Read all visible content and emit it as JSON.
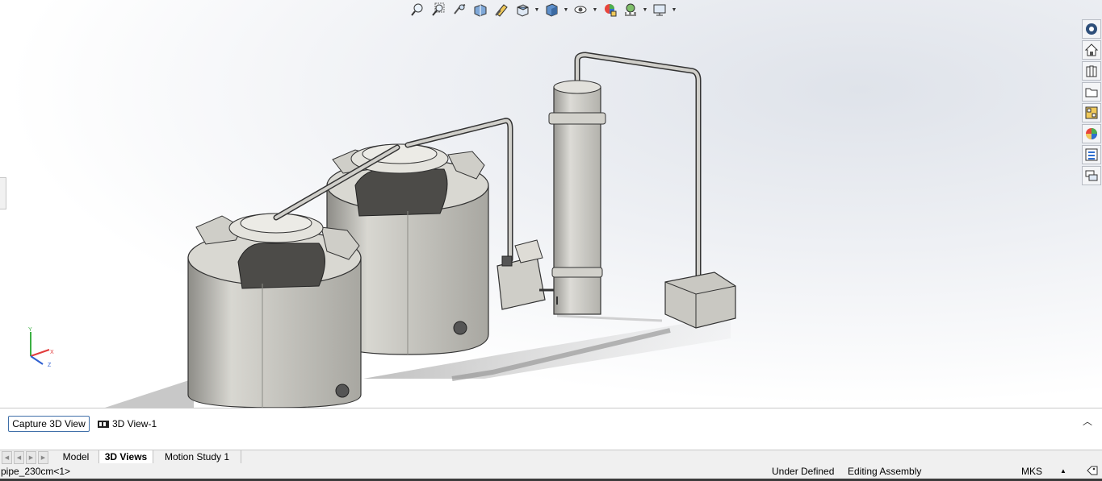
{
  "view_toolbar": {
    "icons": [
      "zoom-to-fit-icon",
      "zoom-to-area-icon",
      "previous-view-icon",
      "section-view-icon",
      "dynamic-annotation-icon",
      "view-orientation-icon",
      "display-style-icon",
      "hide-show-items-icon",
      "edit-appearance-icon",
      "apply-scene-icon",
      "view-settings-icon"
    ]
  },
  "task_pane": {
    "icons": [
      "solidworks-resources-icon",
      "home-icon",
      "design-library-icon",
      "file-explorer-icon",
      "view-palette-icon",
      "appearances-scenes-icon",
      "custom-properties-icon",
      "forum-icon"
    ]
  },
  "triad": {
    "x": "X",
    "y": "Y",
    "z": "Z"
  },
  "bottom_panel": {
    "capture_label": "Capture 3D View",
    "view_item_label": "3D View-1"
  },
  "tabs": {
    "model": "Model",
    "views_3d": "3D Views",
    "motion_study": "Motion Study 1",
    "active": "3D Views"
  },
  "status": {
    "selected_item": "pipe_230cm<1>",
    "definition_state": "Under Defined",
    "mode": "Editing Assembly",
    "units": "MKS"
  },
  "colors": {
    "accent_blue": "#3f6fa8",
    "status_bar_bg": "#f0f0f0",
    "tank_gray": "#c9c8c2"
  }
}
